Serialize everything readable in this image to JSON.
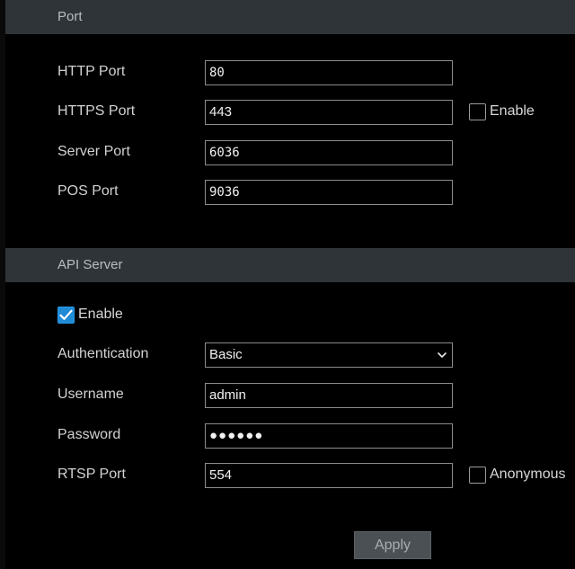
{
  "sections": {
    "port": {
      "title": "Port"
    },
    "api_server": {
      "title": "API Server"
    }
  },
  "port": {
    "http_label": "HTTP Port",
    "http_value": "80",
    "https_label": "HTTPS Port",
    "https_value": "443",
    "https_enable_label": "Enable",
    "https_enable_checked": false,
    "server_label": "Server Port",
    "server_value": "6036",
    "pos_label": "POS Port",
    "pos_value": "9036"
  },
  "api": {
    "enable_label": "Enable",
    "enable_checked": true,
    "auth_label": "Authentication",
    "auth_value": "Basic",
    "username_label": "Username",
    "username_value": "admin",
    "password_label": "Password",
    "password_mask": "●●●●●●",
    "rtsp_label": "RTSP Port",
    "rtsp_value": "554",
    "anonymous_label": "Anonymous",
    "anonymous_checked": false
  },
  "actions": {
    "apply_label": "Apply"
  },
  "colors": {
    "header_bg": "#2f3438",
    "checkbox_checked": "#1f8ad6",
    "button_bg": "#4a5054"
  }
}
